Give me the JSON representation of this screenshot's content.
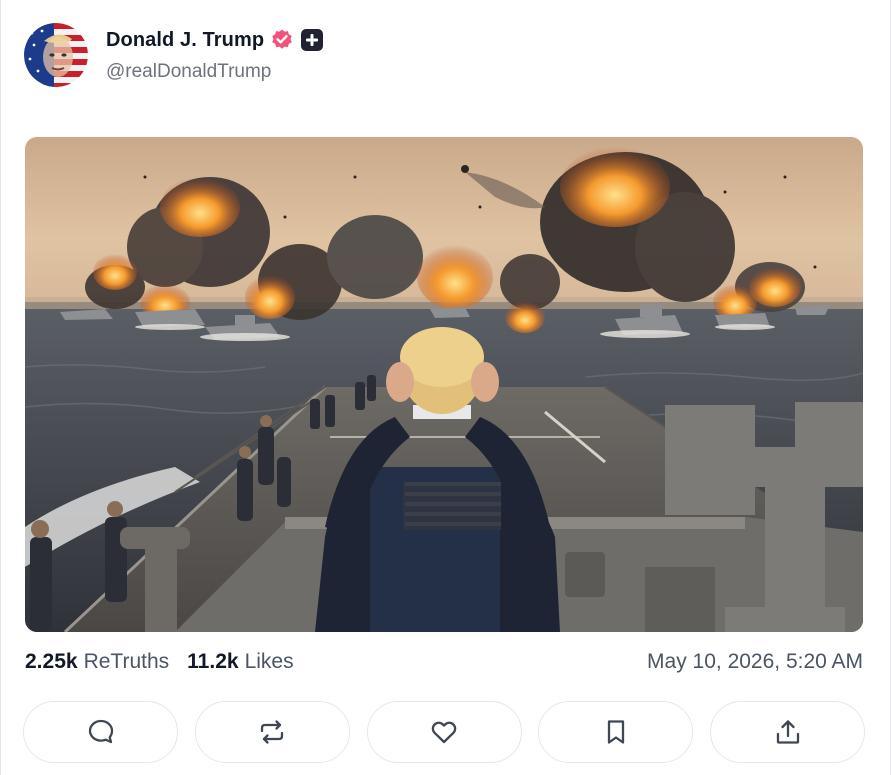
{
  "author": {
    "display_name": "Donald J. Trump",
    "handle": "@realDonaldTrump",
    "avatar_icon": "flag-portrait-avatar",
    "verified_icon": "verified-badge-icon",
    "plus_icon": "plus-badge-icon",
    "verified_color": "#f0547c"
  },
  "media": {
    "icon": "ai-image-navy-battle"
  },
  "stats": {
    "retruths_count": "2.25k",
    "retruths_label": "ReTruths",
    "likes_count": "11.2k",
    "likes_label": "Likes"
  },
  "timestamp": "May 10, 2026, 5:20 AM",
  "actions": [
    {
      "name": "reply",
      "icon": "comment-icon"
    },
    {
      "name": "retruth",
      "icon": "repost-icon"
    },
    {
      "name": "like",
      "icon": "heart-icon"
    },
    {
      "name": "bookmark",
      "icon": "bookmark-icon"
    },
    {
      "name": "share",
      "icon": "share-icon"
    }
  ]
}
